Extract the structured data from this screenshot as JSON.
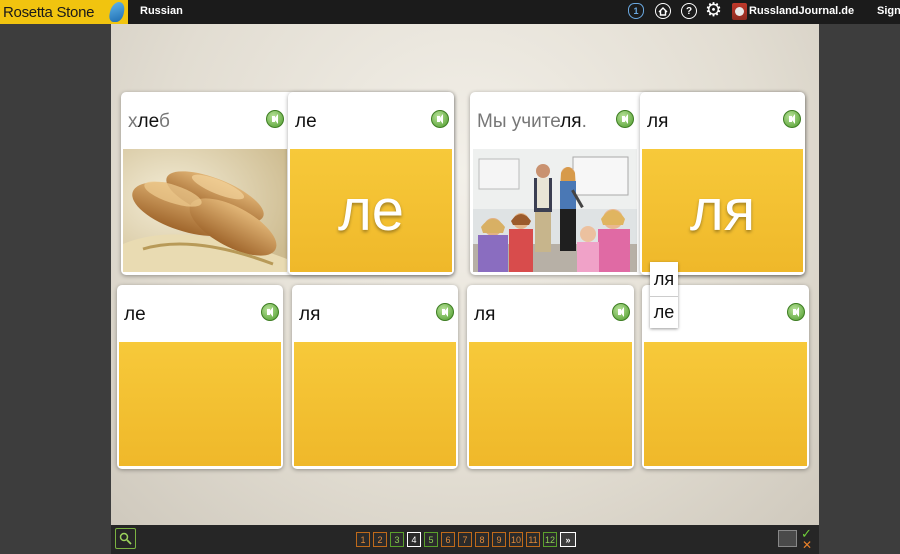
{
  "topbar": {
    "brand": "Rosetta Stone",
    "course": "Russian",
    "unit_badge": "1",
    "help_glyph": "?",
    "user": "RusslandJournal.de",
    "signout": "Sign"
  },
  "icons": {
    "home": "home-icon",
    "help": "help-icon",
    "settings": "gear-icon",
    "audio": "speaker-icon"
  },
  "prompts": [
    {
      "pre": "х",
      "bold": "ле",
      "post": "б",
      "image": "bread"
    },
    {
      "pre": "Мы учите",
      "bold": "ля",
      "post": ".",
      "image": "classroom"
    }
  ],
  "target_tiles": [
    {
      "label": "ле",
      "big": "ле"
    },
    {
      "label": "ля",
      "big": "ля"
    }
  ],
  "answer_cards": [
    {
      "label": "ле"
    },
    {
      "label": "ля"
    },
    {
      "label": "ля"
    },
    {
      "label": ""
    }
  ],
  "drag_tiles": [
    "ля",
    "ле"
  ],
  "pagination": {
    "pages": [
      {
        "n": "1",
        "state": "orange"
      },
      {
        "n": "2",
        "state": "orange"
      },
      {
        "n": "3",
        "state": "green"
      },
      {
        "n": "4",
        "state": "current"
      },
      {
        "n": "5",
        "state": "green"
      },
      {
        "n": "6",
        "state": "orange"
      },
      {
        "n": "7",
        "state": "orange"
      },
      {
        "n": "8",
        "state": "orange"
      },
      {
        "n": "9",
        "state": "orange"
      },
      {
        "n": "10",
        "state": "orange"
      },
      {
        "n": "11",
        "state": "orange"
      },
      {
        "n": "12",
        "state": "green"
      }
    ],
    "next": "»"
  },
  "colors": {
    "brand_yellow": "#f1c40f",
    "tile_yellow": "#f7c93a",
    "speaker_green": "#4c9a2a",
    "page_orange": "#c06a1a",
    "page_green": "#5aa02c"
  }
}
